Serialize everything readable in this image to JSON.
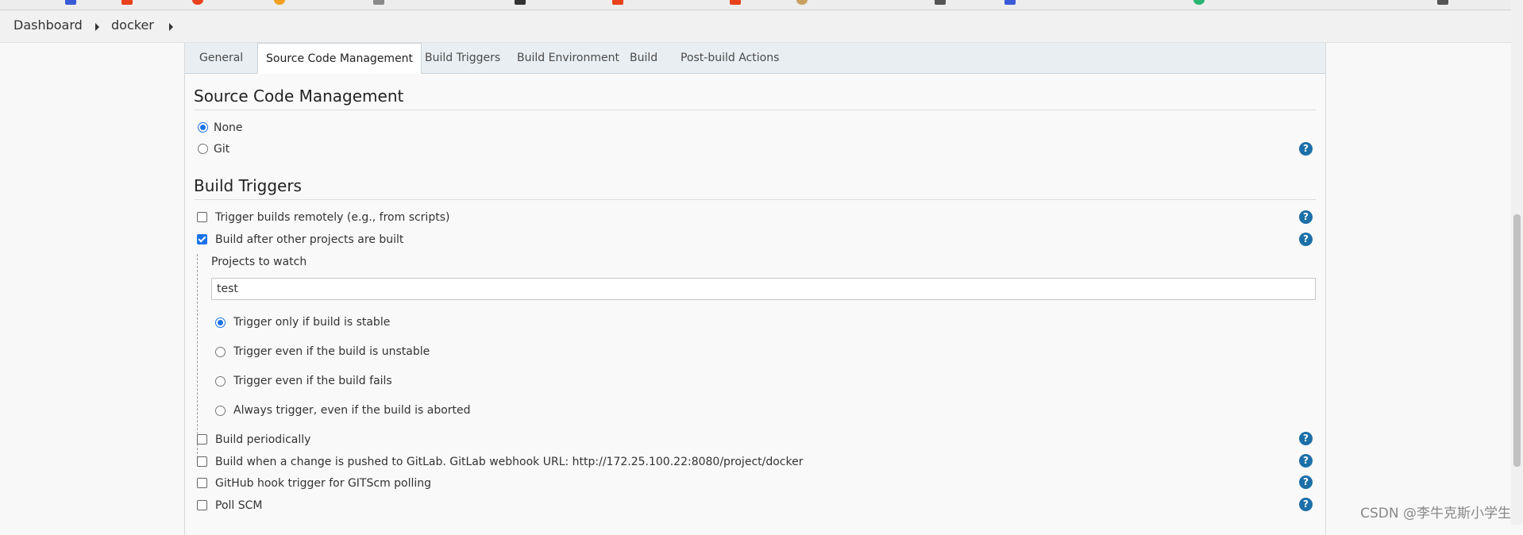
{
  "breadcrumb": {
    "items": [
      "Dashboard",
      "docker"
    ]
  },
  "tabs": [
    {
      "label": "General",
      "active": false
    },
    {
      "label": "Source Code Management",
      "active": true
    },
    {
      "label": "Build Triggers",
      "active": false
    },
    {
      "label": "Build Environment",
      "active": false
    },
    {
      "label": "Build",
      "active": false
    },
    {
      "label": "Post-build Actions",
      "active": false
    }
  ],
  "scm": {
    "title": "Source Code Management",
    "options": [
      {
        "label": "None",
        "selected": true
      },
      {
        "label": "Git",
        "selected": false
      }
    ]
  },
  "triggers": {
    "title": "Build Triggers",
    "remote": {
      "label": "Trigger builds remotely (e.g., from scripts)",
      "checked": false
    },
    "after_other": {
      "label": "Build after other projects are built",
      "checked": true
    },
    "projects_to_watch": {
      "label": "Projects to watch",
      "value": "test"
    },
    "conditions": [
      {
        "label": "Trigger only if build is stable",
        "selected": true
      },
      {
        "label": "Trigger even if the build is unstable",
        "selected": false
      },
      {
        "label": "Trigger even if the build fails",
        "selected": false
      },
      {
        "label": "Always trigger, even if the build is aborted",
        "selected": false
      }
    ],
    "periodically": {
      "label": "Build periodically",
      "checked": false
    },
    "gitlab": {
      "label": "Build when a change is pushed to GitLab. GitLab webhook URL: http://172.25.100.22:8080/project/docker",
      "checked": false
    },
    "github": {
      "label": "GitHub hook trigger for GITScm polling",
      "checked": false
    },
    "poll_scm": {
      "label": "Poll SCM",
      "checked": false
    }
  },
  "help_glyph": "?",
  "watermark": "CSDN @李牛克斯小学生",
  "colors": {
    "accent": "#1a73e8",
    "help_icon": "#1c6fa8",
    "tab_bar": "#e9eef2"
  }
}
